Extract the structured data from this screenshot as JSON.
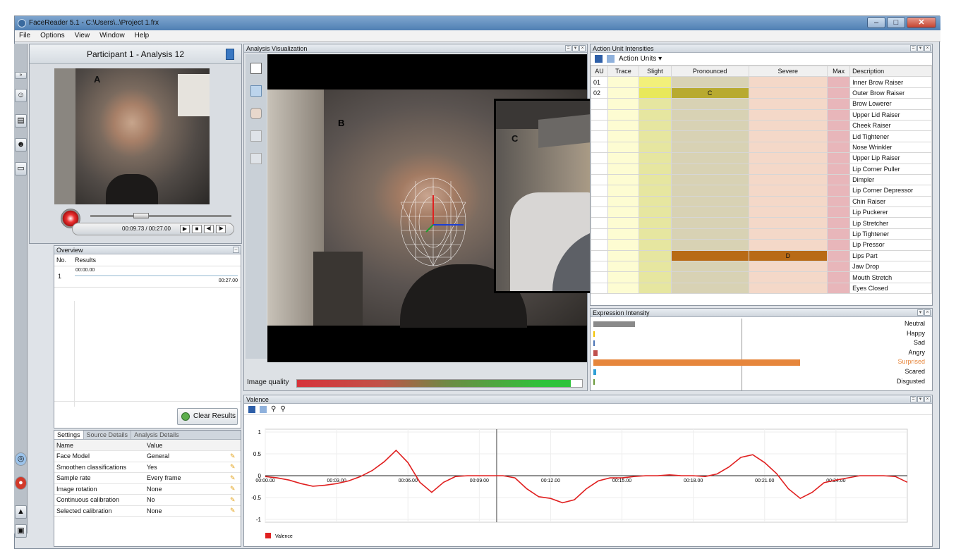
{
  "window": {
    "title": "FaceReader 5.1 - C:\\Users\\..\\Project 1.frx",
    "controls": [
      "–",
      "□",
      "✕"
    ]
  },
  "menu": [
    "File",
    "Options",
    "View",
    "Window",
    "Help"
  ],
  "participant": {
    "title": "Participant 1 - Analysis 12"
  },
  "labels": {
    "a": "A",
    "b": "B",
    "c": "C"
  },
  "player": {
    "time": "00:09.73 / 00:27.00",
    "progress": 0.36
  },
  "overview": {
    "title": "Overview",
    "columns": [
      "No.",
      "Results"
    ],
    "rows": [
      {
        "no": "1",
        "start": "00:00.00",
        "end": "00:27.00"
      }
    ],
    "clear_label": "Clear Results"
  },
  "settings": {
    "tabs": [
      "Settings",
      "Source Details",
      "Analysis Details"
    ],
    "columns": [
      "Name",
      "Value"
    ],
    "rows": [
      {
        "name": "Face Model",
        "value": "General"
      },
      {
        "name": "Smoothen classifications",
        "value": "Yes"
      },
      {
        "name": "Sample rate",
        "value": "Every frame"
      },
      {
        "name": "Image rotation",
        "value": "None"
      },
      {
        "name": "Continuous calibration",
        "value": "No"
      },
      {
        "name": "Selected calibration",
        "value": "None"
      }
    ]
  },
  "analysis": {
    "title": "Analysis Visualization",
    "image_quality_label": "Image quality"
  },
  "au": {
    "title": "Action Unit Intensities",
    "dropdown": "Action Units",
    "columns": [
      "AU",
      "Trace",
      "Slight",
      "Pronounced",
      "Severe",
      "Max",
      "Description"
    ],
    "rows": [
      {
        "au": "01",
        "mark": "",
        "desc": "Inner Brow Raiser"
      },
      {
        "au": "02",
        "mark": "C",
        "desc": "Outer Brow Raiser"
      },
      {
        "au": "",
        "mark": "",
        "desc": "Brow Lowerer"
      },
      {
        "au": "",
        "mark": "",
        "desc": "Upper Lid Raiser"
      },
      {
        "au": "",
        "mark": "",
        "desc": "Cheek Raiser"
      },
      {
        "au": "",
        "mark": "",
        "desc": "Lid Tightener"
      },
      {
        "au": "",
        "mark": "",
        "desc": "Nose Wrinkler"
      },
      {
        "au": "",
        "mark": "",
        "desc": "Upper Lip Raiser"
      },
      {
        "au": "",
        "mark": "",
        "desc": "Lip Corner Puller"
      },
      {
        "au": "",
        "mark": "",
        "desc": "Dimpler"
      },
      {
        "au": "",
        "mark": "",
        "desc": "Lip Corner Depressor"
      },
      {
        "au": "",
        "mark": "",
        "desc": "Chin Raiser"
      },
      {
        "au": "",
        "mark": "",
        "desc": "Lip Puckerer"
      },
      {
        "au": "",
        "mark": "",
        "desc": "Lip Stretcher"
      },
      {
        "au": "",
        "mark": "",
        "desc": "Lip Tightener"
      },
      {
        "au": "",
        "mark": "",
        "desc": "Lip Pressor"
      },
      {
        "au": "",
        "mark": "D",
        "desc": "Lips Part"
      },
      {
        "au": "",
        "mark": "",
        "desc": "Jaw Drop"
      },
      {
        "au": "",
        "mark": "",
        "desc": "Mouth Stretch"
      },
      {
        "au": "",
        "mark": "",
        "desc": "Eyes Closed"
      }
    ]
  },
  "expression": {
    "title": "Expression Intensity",
    "items": [
      {
        "label": "Neutral",
        "value": 0.14,
        "color": "#8a8a8a"
      },
      {
        "label": "Happy",
        "value": 0.0,
        "color": "#f2c200"
      },
      {
        "label": "Sad",
        "value": 0.0,
        "color": "#4a74b5"
      },
      {
        "label": "Angry",
        "value": 0.015,
        "color": "#c0504d"
      },
      {
        "label": "Surprised",
        "value": 0.69,
        "color": "#e6863c"
      },
      {
        "label": "Scared",
        "value": 0.01,
        "color": "#2f9fd6"
      },
      {
        "label": "Disgusted",
        "value": 0.003,
        "color": "#6a9a3a"
      }
    ]
  },
  "chart_data": {
    "type": "line",
    "title": "Valence",
    "xlabel": "",
    "ylabel": "",
    "ylim": [
      -1,
      1
    ],
    "yticks": [
      "1",
      "0.5",
      "0",
      "-0.5",
      "-1"
    ],
    "xticks": [
      "00:00.00",
      "00:03.00",
      "00:06.00",
      "00:09.00",
      "00:12.00",
      "00:15.00",
      "00:18.00",
      "00:21.00",
      "00:24.00"
    ],
    "xlim": [
      0,
      27
    ],
    "cursor": 9.73,
    "series": [
      {
        "name": "Valence",
        "color": "#e02020",
        "x": [
          0,
          0.5,
          1,
          1.5,
          2,
          2.5,
          3,
          3.5,
          4,
          4.5,
          5,
          5.5,
          6,
          6.5,
          7,
          7.5,
          8,
          8.5,
          9,
          9.5,
          10,
          10.5,
          11,
          11.5,
          12,
          12.5,
          13,
          13.5,
          14,
          14.5,
          15,
          15.5,
          16,
          16.5,
          17,
          17.5,
          18,
          18.5,
          19,
          19.5,
          20,
          20.5,
          21,
          21.5,
          22,
          22.5,
          23,
          23.5,
          24,
          24.5,
          25,
          25.5,
          26,
          26.5,
          27
        ],
        "y": [
          -0.02,
          -0.05,
          -0.1,
          -0.18,
          -0.24,
          -0.22,
          -0.18,
          -0.12,
          -0.02,
          0.12,
          0.32,
          0.58,
          0.3,
          -0.15,
          -0.38,
          -0.15,
          -0.02,
          0.0,
          0.0,
          0.0,
          0.0,
          -0.05,
          -0.3,
          -0.48,
          -0.52,
          -0.62,
          -0.55,
          -0.3,
          -0.12,
          -0.05,
          -0.05,
          -0.02,
          0.0,
          0.0,
          0.02,
          0.0,
          0.0,
          -0.02,
          0.04,
          0.2,
          0.42,
          0.48,
          0.3,
          0.05,
          -0.3,
          -0.52,
          -0.38,
          -0.16,
          -0.1,
          -0.05,
          0.0,
          0.0,
          0.0,
          -0.02,
          -0.15
        ]
      }
    ]
  }
}
